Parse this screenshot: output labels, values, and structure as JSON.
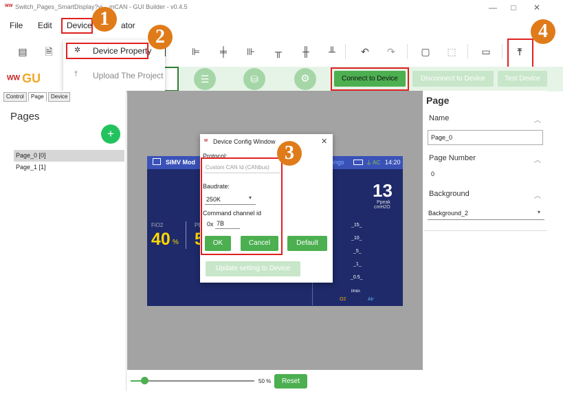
{
  "window": {
    "title": "Switch_Pages_SmartDisplay?vi... mCAN - GUI Builder - v0.4.5",
    "controls": {
      "minimize": "—",
      "maximize": "□",
      "close": "✕"
    }
  },
  "menubar": {
    "file": "File",
    "edit": "Edit",
    "device": "Device",
    "simulator": "ator"
  },
  "device_menu": {
    "device_property": "Device Property",
    "upload_project": "Upload The Project"
  },
  "logo": {
    "text": "GU"
  },
  "left_tabs": {
    "control": "Control",
    "page": "Page",
    "device": "Device"
  },
  "pages": {
    "title": "Pages",
    "add": "+",
    "items": [
      "Page_0 [0]",
      "Page_1 [1]"
    ]
  },
  "action_buttons": {
    "connect": "Connect to Device",
    "disconnect": "Disconnect to Device",
    "test": "Test Device"
  },
  "screen_preview": {
    "mode": "SIMV Mod",
    "tab": "ings",
    "battery_label": "AC",
    "time": "14:20",
    "big_value": "13",
    "big_sub1": "Ppeak",
    "big_sub2": "cmH2O",
    "fio2_label": "FiO2",
    "fio2_value": "40",
    "fio2_unit": "%",
    "pe_label": "PE",
    "pe_value": "5",
    "scale": [
      "_15_",
      "_10_",
      "_5_",
      "_1_",
      "_0.5_"
    ],
    "scale_unit": "l/min",
    "o2": "O2",
    "air": "Air"
  },
  "dialog": {
    "title": "Device Config Window",
    "close": "✕",
    "protocol_label": "Protocol:",
    "protocol_value": "Custom CAN Id (CANbus)",
    "baudrate_label": "Baudrate:",
    "baudrate_value": "250K",
    "channel_label": "Command channel id",
    "channel_prefix": "0x",
    "channel_value": "7B",
    "ok": "OK",
    "cancel": "Cancel",
    "default": "Default",
    "update": "Update setting to Device"
  },
  "right_panel": {
    "title": "Page",
    "name_label": "Name",
    "name_value": "Page_0",
    "page_number_label": "Page Number",
    "page_number_value": "0",
    "background_label": "Background",
    "background_value": "Background_2"
  },
  "zoom": {
    "value": "50 %",
    "reset": "Reset",
    "level_percent": 50
  },
  "callouts": [
    "1",
    "2",
    "3",
    "4"
  ],
  "colors": {
    "accent_green": "#4caf50",
    "callout_orange": "#e07b1a",
    "highlight_red": "#e02020",
    "screen_navy": "#1e2a6a"
  }
}
